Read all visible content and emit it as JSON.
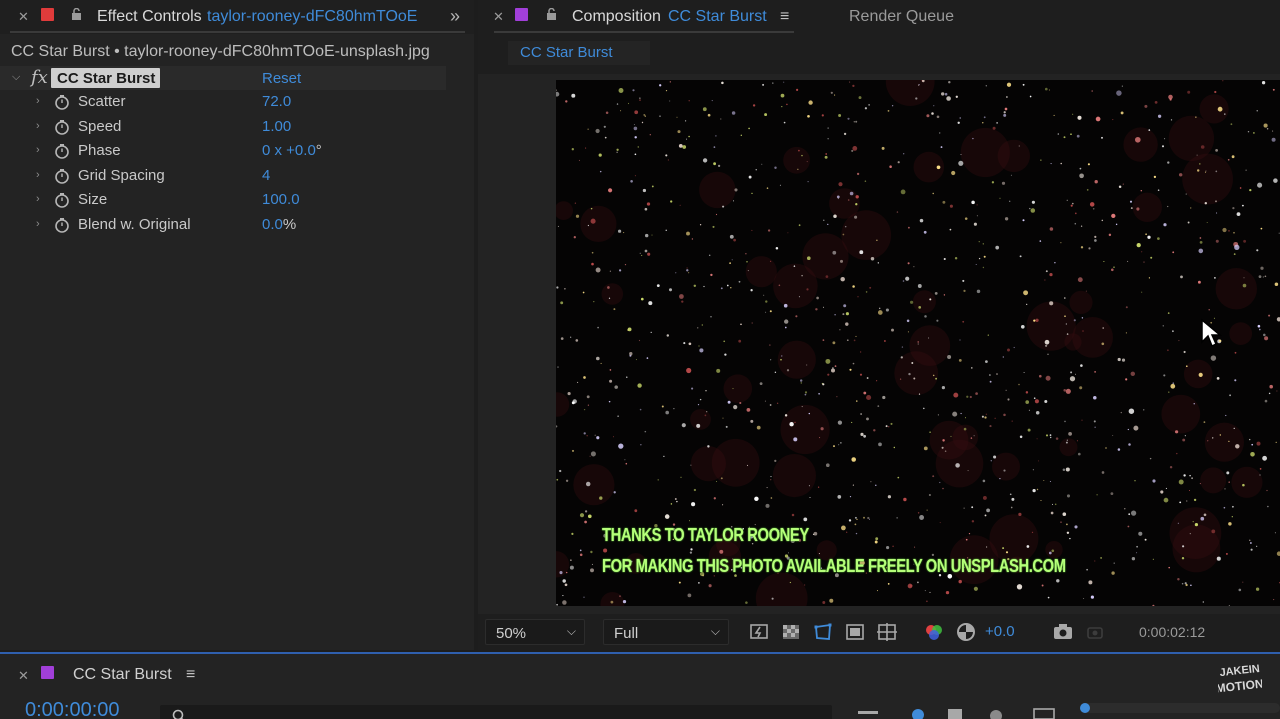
{
  "effect_controls": {
    "tab_label": "Effect Controls",
    "tab_source": "taylor-rooney-dFC80hmTOoE",
    "file_label": "CC Star Burst • taylor-rooney-dFC80hmTOoE-unsplash.jpg",
    "effect": {
      "badge": "fx",
      "name": "CC Star Burst",
      "reset": "Reset"
    },
    "properties": [
      {
        "name": "Scatter",
        "value": "72.0",
        "unit": ""
      },
      {
        "name": "Speed",
        "value": "1.00",
        "unit": ""
      },
      {
        "name": "Phase",
        "value": "0 x +0.0",
        "unit": "°"
      },
      {
        "name": "Grid Spacing",
        "value": "4",
        "unit": ""
      },
      {
        "name": "Size",
        "value": "100.0",
        "unit": ""
      },
      {
        "name": "Blend w. Original",
        "value": "0.0",
        "unit": "%"
      }
    ]
  },
  "composition": {
    "tab_label": "Composition",
    "tab_name": "CC Star Burst",
    "render_queue": "Render Queue",
    "subtab": "CC Star Burst",
    "credit_line1": "THANKS TO TAYLOR ROONEY",
    "credit_line2": "FOR MAKING THIS PHOTO AVAILABLE FREELY ON UNSPLASH.COM",
    "toolbar": {
      "zoom": "50%",
      "resolution": "Full",
      "exposure": "+0.0",
      "timecode": "0:00:02:12"
    }
  },
  "timeline": {
    "name": "CC Star Burst",
    "time": "0:00:00:00"
  },
  "logo_text": "JAKE IN MOTION",
  "colors": {
    "accent": "#3f8bd9",
    "effect_swatch": "#e03b3b",
    "comp_swatch": "#a13fd9",
    "credit_text": "#b6ff7a"
  }
}
